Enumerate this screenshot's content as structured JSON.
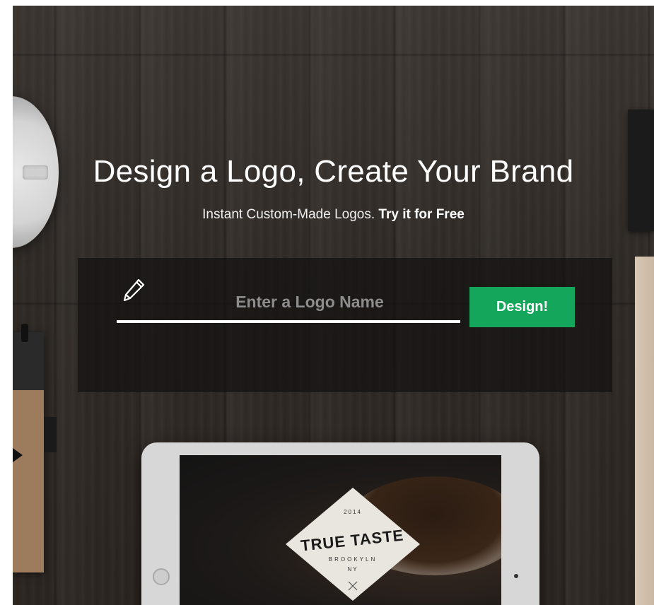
{
  "hero": {
    "title": "Design a Logo, Create Your Brand",
    "subtitle_prefix": "Instant Custom-Made Logos.",
    "subtitle_cta": "Try it for Free"
  },
  "form": {
    "input_placeholder": "Enter a Logo Name",
    "input_value": "",
    "button_label": "Design!",
    "pencil_icon": "pencil-icon"
  },
  "mockup": {
    "badge_year": "2014",
    "badge_name": "TRUE TASTE",
    "badge_city": "BROOKYLN",
    "badge_state": "NY"
  },
  "colors": {
    "button_green": "#14a65a",
    "panel_overlay": "rgba(20,18,16,0.72)",
    "text_white": "#ffffff"
  }
}
